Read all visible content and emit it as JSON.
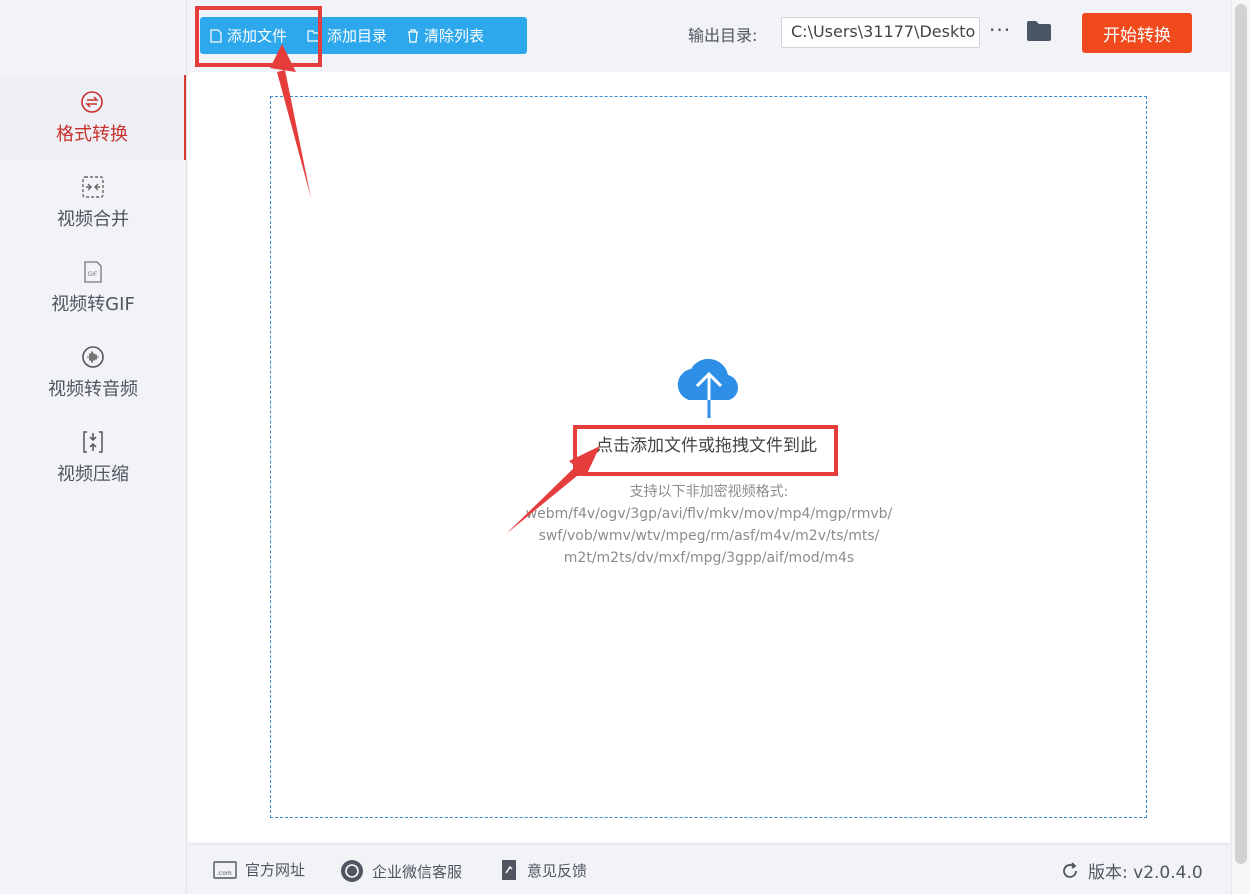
{
  "sidebar": {
    "items": [
      {
        "label": "格式转换",
        "icon": "format-convert-icon",
        "active": true
      },
      {
        "label": "视频合并",
        "icon": "merge-icon",
        "active": false
      },
      {
        "label": "视频转GIF",
        "icon": "gif-icon",
        "active": false
      },
      {
        "label": "视频转音频",
        "icon": "audio-icon",
        "active": false
      },
      {
        "label": "视频压缩",
        "icon": "compress-icon",
        "active": false
      }
    ]
  },
  "toolbar": {
    "add_file": "添加文件",
    "add_folder": "添加目录",
    "clear_list": "清除列表"
  },
  "output": {
    "label": "输出目录:",
    "path": "C:\\Users\\31177\\Deskto",
    "more": "···"
  },
  "start_button": "开始转换",
  "dropzone": {
    "title": "点击添加文件或拖拽文件到此",
    "formats_heading": "支持以下非加密视频格式:",
    "formats_lines": [
      "webm/f4v/ogv/3gp/avi/flv/mkv/mov/mp4/mgp/rmvb/",
      "swf/vob/wmv/wtv/mpeg/rm/asf/m4v/m2v/ts/mts/",
      "m2t/m2ts/dv/mxf/mpg/3gpp/aif/mod/m4s"
    ]
  },
  "footer": {
    "website": "官方网址",
    "wechat": "企业微信客服",
    "feedback": "意见反馈",
    "version": "版本:  v2.0.4.0"
  },
  "colors": {
    "accent_blue": "#2ea8ec",
    "start_red": "#f04a1c",
    "annotation_red": "#e53c3c",
    "active_red": "#c9302c"
  }
}
